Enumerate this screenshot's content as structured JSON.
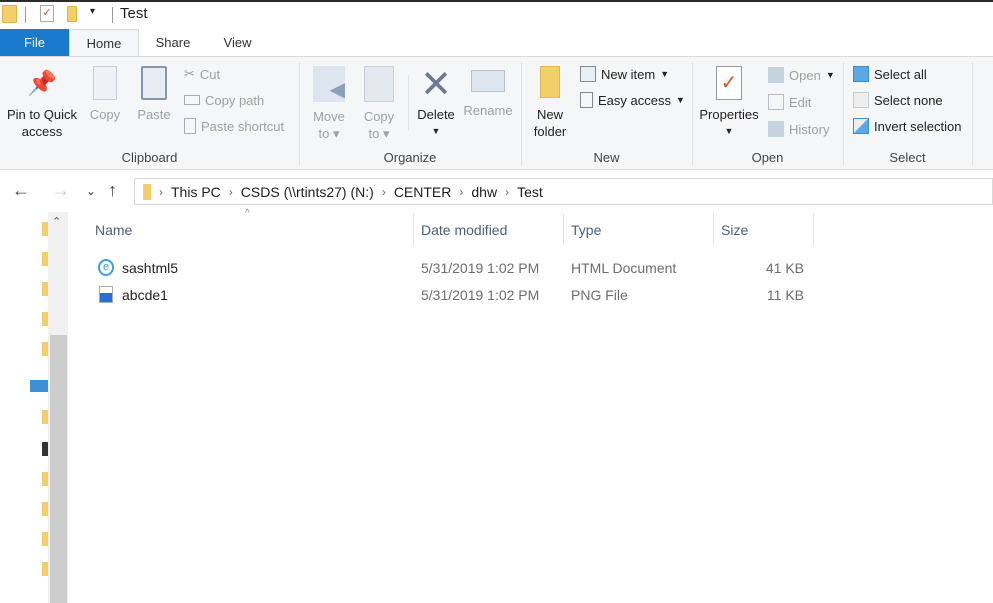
{
  "window": {
    "title": "Test"
  },
  "tabs": [
    {
      "label": "File"
    },
    {
      "label": "Home"
    },
    {
      "label": "Share"
    },
    {
      "label": "View"
    }
  ],
  "ribbon": {
    "clipboard": {
      "label": "Clipboard",
      "pin": "Pin to Quick access",
      "pin1": "Pin to Quick",
      "pin2": "access",
      "copy": "Copy",
      "paste": "Paste",
      "cut": "Cut",
      "copy_path": "Copy path",
      "paste_shortcut": "Paste shortcut"
    },
    "organize": {
      "label": "Organize",
      "move1": "Move",
      "move2": "to",
      "copy1": "Copy",
      "copy2": "to",
      "delete": "Delete",
      "rename": "Rename"
    },
    "new": {
      "label": "New",
      "new1": "New",
      "new2": "folder",
      "new_item": "New item",
      "easy_access": "Easy access"
    },
    "open": {
      "label": "Open",
      "properties": "Properties",
      "open": "Open",
      "edit": "Edit",
      "history": "History"
    },
    "select": {
      "label": "Select",
      "select_all": "Select all",
      "select_none": "Select none",
      "invert": "Invert selection"
    }
  },
  "breadcrumb": [
    "This PC",
    "CSDS (\\\\rtints27) (N:)",
    "CENTER",
    "dhw",
    "Test"
  ],
  "columns": {
    "name": "Name",
    "date": "Date modified",
    "type": "Type",
    "size": "Size"
  },
  "files": [
    {
      "name": "sashtml5",
      "date": "5/31/2019 1:02 PM",
      "type": "HTML Document",
      "size": "41 KB",
      "icon": "html-file-icon"
    },
    {
      "name": "abcde1",
      "date": "5/31/2019 1:02 PM",
      "type": "PNG File",
      "size": "11 KB",
      "icon": "image-file-icon"
    }
  ],
  "colors": {
    "file_tab": "#1979ca",
    "ribbon_bg": "#f5f6f7",
    "header_text": "#4c607a"
  }
}
